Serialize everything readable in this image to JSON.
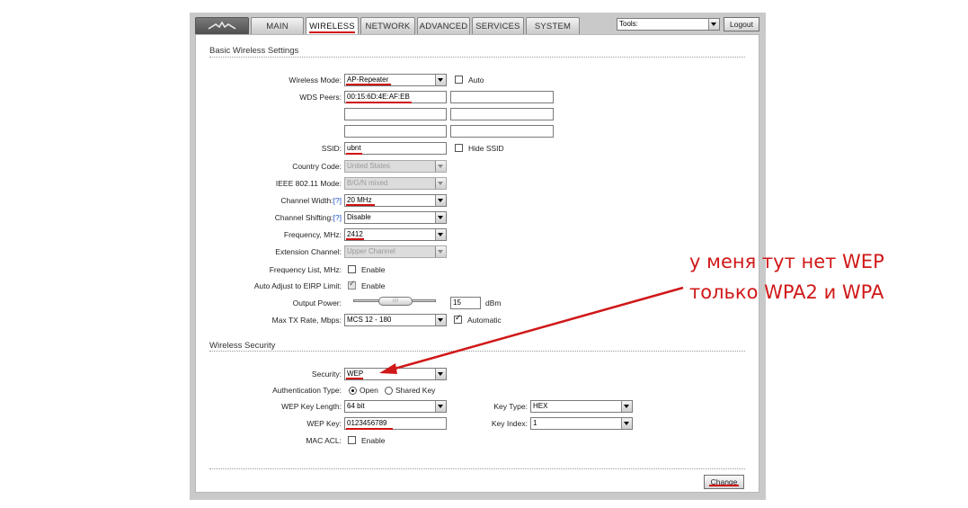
{
  "header": {
    "tabs": [
      {
        "label": "MAIN"
      },
      {
        "label": "WIRELESS"
      },
      {
        "label": "NETWORK"
      },
      {
        "label": "ADVANCED"
      },
      {
        "label": "SERVICES"
      },
      {
        "label": "SYSTEM"
      }
    ],
    "active_tab": "WIRELESS",
    "tools_label": "Tools:",
    "logout_label": "Logout"
  },
  "basic": {
    "section_title": "Basic Wireless Settings",
    "wireless_mode": {
      "label": "Wireless Mode:",
      "value": "AP-Repeater",
      "auto_label": "Auto"
    },
    "wds_peers": {
      "label": "WDS Peers:",
      "values": [
        "00:15:6D:4E:AF:EB",
        "",
        "",
        "",
        "",
        ""
      ]
    },
    "ssid": {
      "label": "SSID:",
      "value": "ubnt",
      "hide_label": "Hide SSID"
    },
    "country_code": {
      "label": "Country Code:",
      "value": "United States"
    },
    "ieee_mode": {
      "label": "IEEE 802.11 Mode:",
      "value": "B/G/N mixed"
    },
    "channel_width": {
      "label": "Channel Width:",
      "help": "[?]",
      "value": "20 MHz"
    },
    "channel_shifting": {
      "label": "Channel Shifting:",
      "help": "[?]",
      "value": "Disable"
    },
    "frequency": {
      "label": "Frequency, MHz:",
      "value": "2412"
    },
    "extension_channel": {
      "label": "Extension Channel:",
      "value": "Upper Channel"
    },
    "frequency_list": {
      "label": "Frequency List, MHz:",
      "enable_label": "Enable"
    },
    "auto_adjust": {
      "label": "Auto Adjust to EIRP Limit:",
      "enable_label": "Enable"
    },
    "output_power": {
      "label": "Output Power:",
      "value": "15",
      "unit": "dBm"
    },
    "max_tx_rate": {
      "label": "Max TX Rate, Mbps:",
      "value": "MCS 12 - 180",
      "auto_label": "Automatic"
    }
  },
  "security": {
    "section_title": "Wireless Security",
    "security": {
      "label": "Security:",
      "value": "WEP"
    },
    "auth_type": {
      "label": "Authentication Type:",
      "open_label": "Open",
      "shared_label": "Shared Key"
    },
    "wep_key_length": {
      "label": "WEP Key Length:",
      "value": "64 bit"
    },
    "key_type": {
      "label": "Key Type:",
      "value": "HEX"
    },
    "wep_key": {
      "label": "WEP Key:",
      "value": "0123456789"
    },
    "key_index": {
      "label": "Key Index:",
      "value": "1"
    },
    "mac_acl": {
      "label": "MAC ACL:",
      "enable_label": "Enable"
    }
  },
  "change_label": "Change",
  "annotation": {
    "line1": "у меня тут нет WEP",
    "line2": "только WPA2 и WPA",
    "color": "#d01818"
  }
}
